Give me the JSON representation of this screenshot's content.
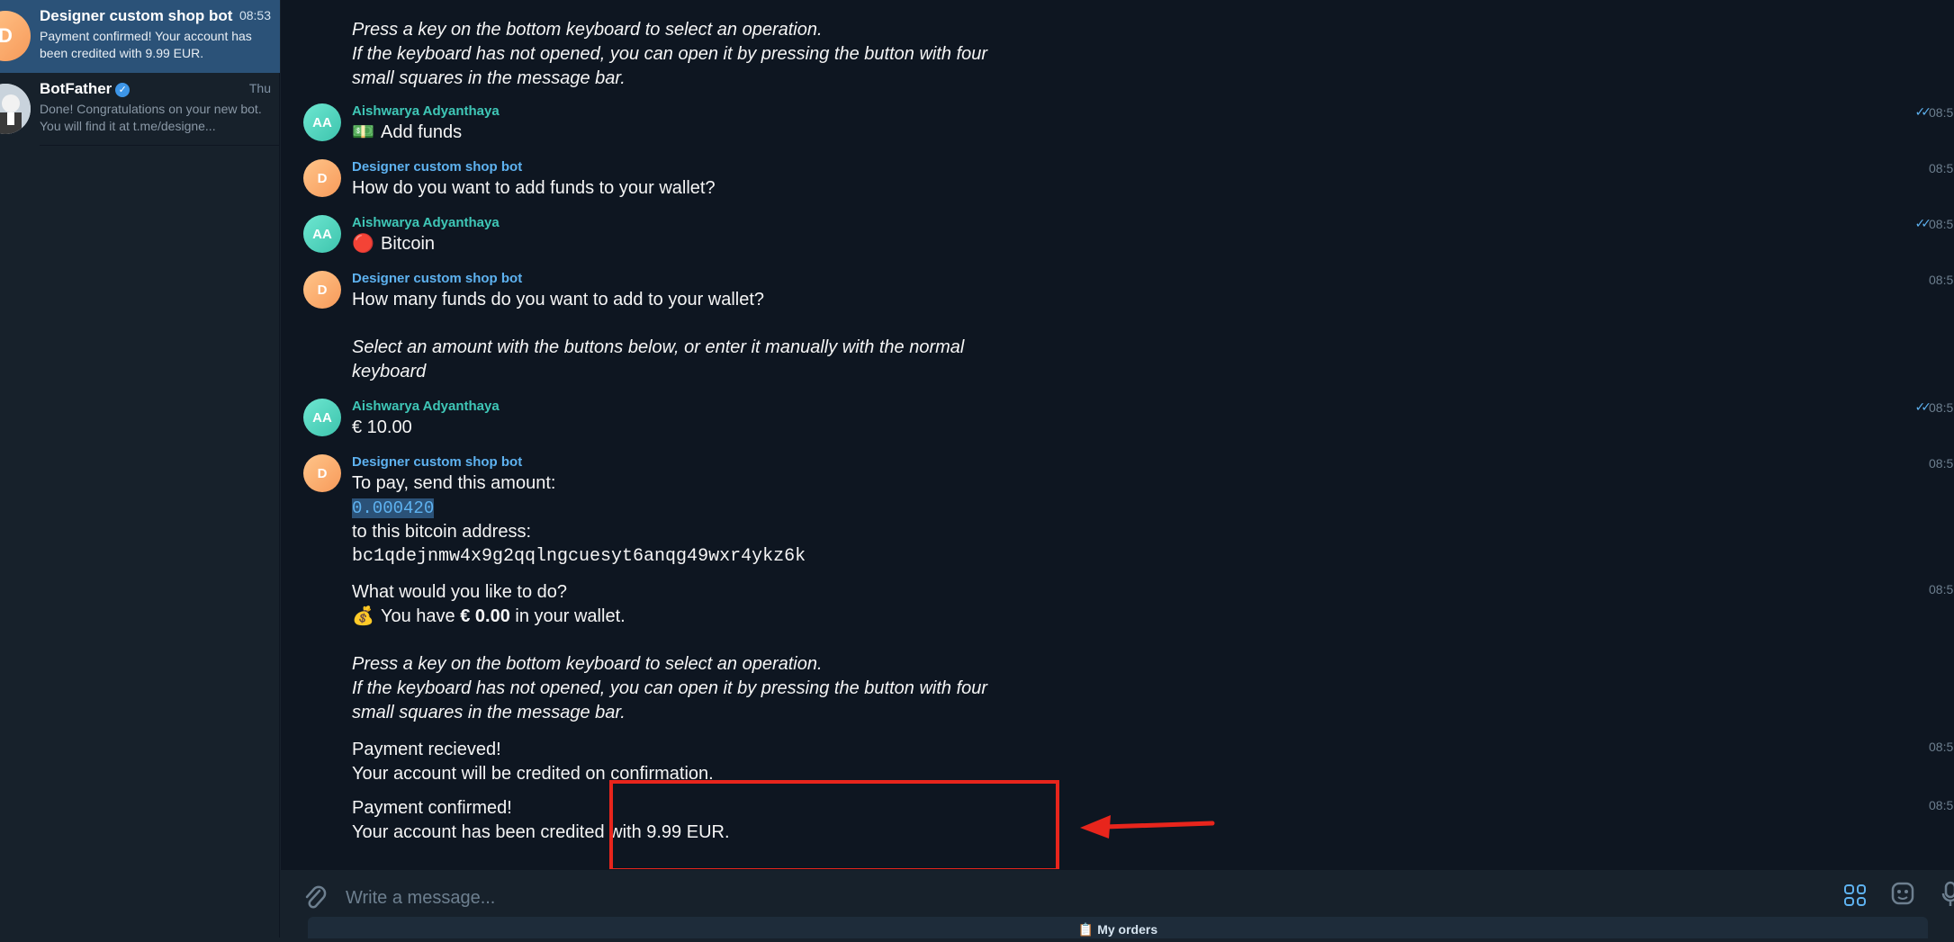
{
  "sidebar": {
    "chats": [
      {
        "avatar_letter": "D",
        "name": "Designer custom shop bot",
        "time": "08:53",
        "preview": "Payment confirmed! Your account has been credited with 9.99 EUR."
      },
      {
        "name": "BotFather",
        "time": "Thu",
        "preview": "Done! Congratulations on your new bot. You will find it at t.me/designe..."
      }
    ]
  },
  "messages": {
    "m0_line1": "Press a key on the bottom keyboard to select an operation.",
    "m0_line2": "If the keyboard has not opened, you can open it by pressing the button with four",
    "m0_line3": "small squares in the message bar.",
    "m1": {
      "avatar": "AA",
      "sender": "Aishwarya Adyanthaya",
      "emoji": "💵",
      "text": "Add funds",
      "time": "08:5"
    },
    "m2": {
      "avatar": "D",
      "sender": "Designer custom shop bot",
      "text": "How do you want to add funds to your wallet?",
      "time": "08:5"
    },
    "m3": {
      "avatar": "AA",
      "sender": "Aishwarya Adyanthaya",
      "emoji": "🔴",
      "text": "Bitcoin",
      "time": "08:5"
    },
    "m4": {
      "avatar": "D",
      "sender": "Designer custom shop bot",
      "text": "How many funds do you want to add to your wallet?",
      "italic1": "Select an amount with the buttons below, or enter it manually with the normal",
      "italic2": "keyboard",
      "time": "08:5"
    },
    "m5": {
      "avatar": "AA",
      "sender": "Aishwarya Adyanthaya",
      "text": "€ 10.00",
      "time": "08:5"
    },
    "m6": {
      "avatar": "D",
      "sender": "Designer custom shop bot",
      "line1": "To pay, send this amount:",
      "amount": "0.000420",
      "line3": "to this bitcoin address:",
      "address": "bc1qdejnmw4x9g2qqlngcuesyt6anqg49wxr4ykz6k",
      "time": "08:5"
    },
    "m7": {
      "line1": "What would you like to do?",
      "emoji": "💰",
      "wallet_prefix": "You have ",
      "wallet_amount": "€ 0.00",
      "wallet_suffix": " in your wallet.",
      "italic1": "Press a key on the bottom keyboard to select an operation.",
      "italic2": "If the keyboard has not opened, you can open it by pressing the button with four",
      "italic3": "small squares in the message bar.",
      "time": "08:5"
    },
    "m8": {
      "line1": "Payment recieved!",
      "line2": "Your account will be credited on confirmation.",
      "time": "08:5"
    },
    "m9": {
      "line1": "Payment confirmed!",
      "line2": "Your account has been credited with 9.99 EUR.",
      "time": "08:5"
    }
  },
  "composer": {
    "placeholder": "Write a message...",
    "keyboard_button": "📋 My orders"
  },
  "colors": {
    "highlight_box": "#e8251c",
    "link": "#5eb2f0",
    "active_chat": "#2b5278"
  }
}
